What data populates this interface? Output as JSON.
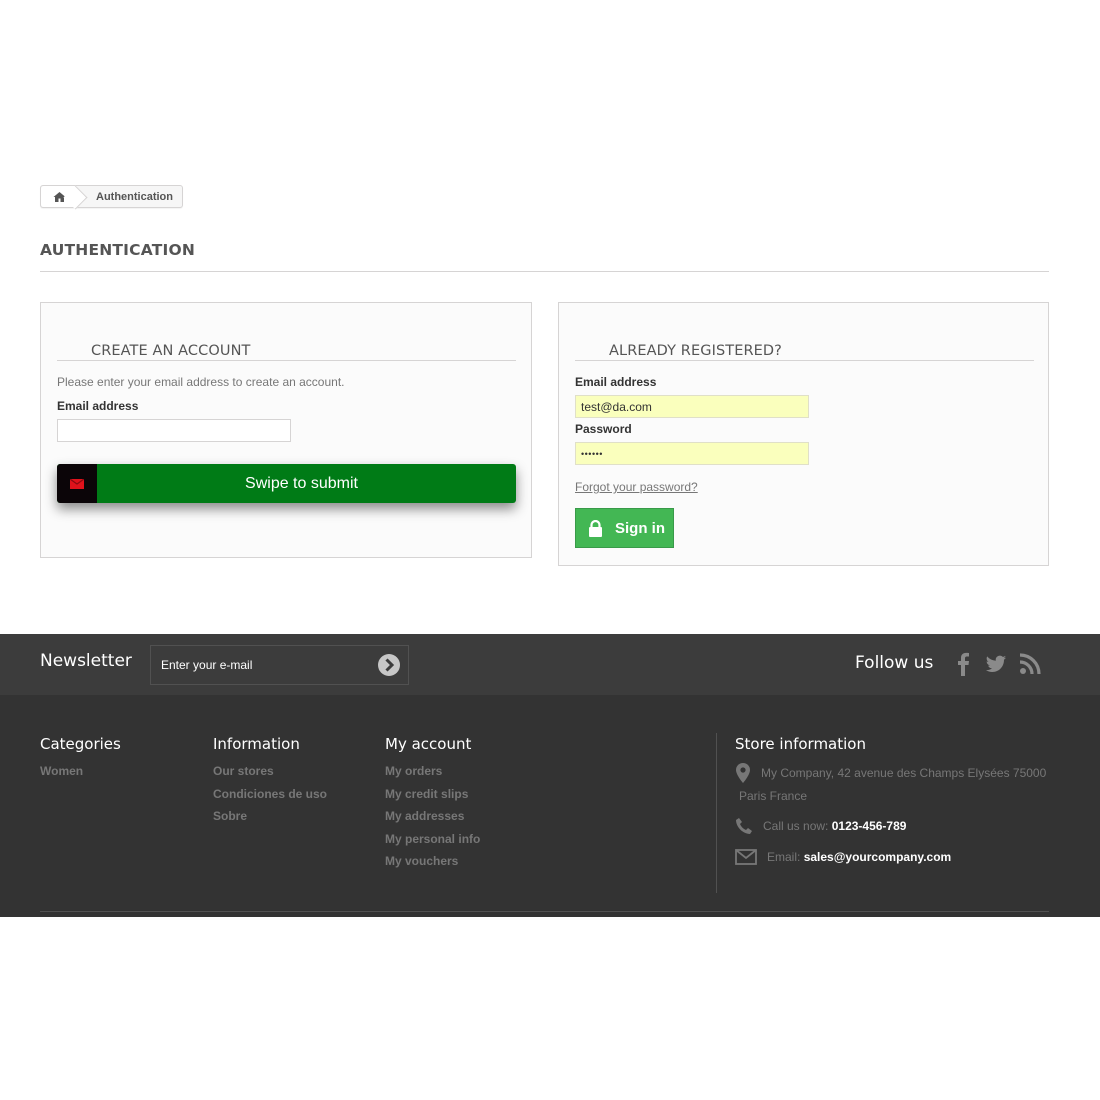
{
  "breadcrumb": {
    "home_icon": "home-icon",
    "current": "Authentication"
  },
  "page_heading": "AUTHENTICATION",
  "create_account": {
    "title": "CREATE AN ACCOUNT",
    "description": "Please enter your email address to create an account.",
    "email_label": "Email address",
    "email_value": "",
    "swipe_label": "Swipe to submit",
    "swipe_icon": "envelope-icon"
  },
  "login": {
    "title": "ALREADY REGISTERED?",
    "email_label": "Email address",
    "email_value": "test@da.com",
    "password_label": "Password",
    "password_value": "••••••",
    "forgot_link": "Forgot your password?",
    "signin_label": "Sign in",
    "signin_icon": "lock-icon"
  },
  "footer": {
    "newsletter": {
      "title": "Newsletter",
      "placeholder": "Enter your e-mail"
    },
    "follow_us": "Follow us",
    "social_icons": [
      "facebook-icon",
      "twitter-icon",
      "rss-icon"
    ],
    "columns": {
      "categories": {
        "title": "Categories",
        "items": [
          "Women"
        ]
      },
      "information": {
        "title": "Information",
        "items": [
          "Our stores",
          "Condiciones de uso",
          "Sobre"
        ]
      },
      "my_account": {
        "title": "My account",
        "items": [
          "My orders",
          "My credit slips",
          "My addresses",
          "My personal info",
          "My vouchers"
        ]
      }
    },
    "store": {
      "title": "Store information",
      "address_line1": "My Company, 42 avenue des Champs Elysées 75000",
      "address_line2": "Paris France",
      "call_label": "Call us now:",
      "phone": "0123-456-789",
      "email_label": "Email:",
      "email": "sales@yourcompany.com"
    }
  },
  "colors": {
    "swipe_green": "#007b16",
    "signin_green": "#43b754",
    "autofill_yellow": "#faffbd",
    "footer_dark": "#333333",
    "newsletter_bar": "#3c3c3c"
  }
}
